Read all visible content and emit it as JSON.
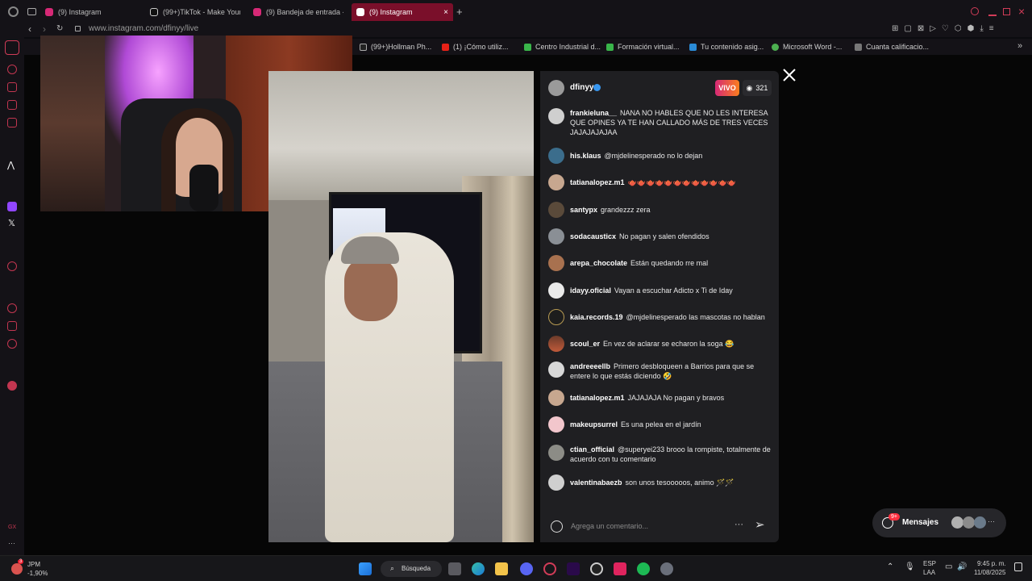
{
  "browser": {
    "tabs": [
      {
        "label": "(9) Instagram",
        "active": false
      },
      {
        "label": "(99+)TikTok - Make Your",
        "active": false
      },
      {
        "label": "(9) Bandeja de entrada -",
        "active": false
      },
      {
        "label": "(9) Instagram",
        "active": true
      }
    ],
    "new_tab": "+",
    "url": "www.instagram.com/dfinyy/live",
    "bookmarks": [
      "(99+)Hollman Ph...",
      "(1) ¡Cómo utiliz...",
      "Centro Industrial d...",
      "Formación virtual...",
      "Tu contenido asig...",
      "Microsoft Word -...",
      "Cuanta calificacio..."
    ]
  },
  "live": {
    "host": "dfinyy",
    "badge": "VIVO",
    "viewers": "321",
    "comments": [
      {
        "user": "frankieluna__",
        "text": "NANA NO HABLES QUE NO LES INTERESA QUE OPINES YA TE HAN CALLADO MÁS DE TRES VECES JAJAJAJAJAA"
      },
      {
        "user": "his.klaus",
        "text": "@mjdelinesperado no lo dejan"
      },
      {
        "user": "tatianalopez.m1",
        "text": "🫖🫖🫖🫖🫖🫖🫖🫖🫖🫖🫖🫖"
      },
      {
        "user": "santypx",
        "text": "grandezzz zera"
      },
      {
        "user": "sodacausticx",
        "text": "No pagan y salen ofendidos"
      },
      {
        "user": "arepa_chocolate",
        "text": "Están quedando rre mal"
      },
      {
        "user": "idayy.oficial",
        "text": "Vayan a escuchar Adicto x Ti de Iday"
      },
      {
        "user": "kaia.records.19",
        "text": "@mjdelinesperado las mascotas no hablan"
      },
      {
        "user": "scoul_er",
        "text": "En vez de aclarar se echaron la soga 😂"
      },
      {
        "user": "andreeeellb",
        "text": "Primero desbloqueen a Barrios para que se entere lo que estás diciendo 🤣"
      },
      {
        "user": "tatianalopez.m1",
        "text": "JAJAJAJA No pagan y bravos"
      },
      {
        "user": "makeupsurrel",
        "text": "Es una pelea en el jardín"
      },
      {
        "user": "ctian_official",
        "text": "@superyei233 brooo la rompiste, totalmente de acuerdo con tu comentario"
      },
      {
        "user": "valentinabaezb",
        "text": "son unos tesooooos, animo 🪄🪄"
      }
    ],
    "composer_placeholder": "Agrega un comentario...",
    "more": "···"
  },
  "messages": {
    "label": "Mensajes",
    "badge": "9+"
  },
  "taskbar": {
    "stock_name": "JPM",
    "stock_change": "-1,90%",
    "stock_badge": "3",
    "search": "Búsqueda",
    "lang": "ESP",
    "lang2": "LAA",
    "time": "9:45 p. m.",
    "date": "11/08/2025"
  }
}
